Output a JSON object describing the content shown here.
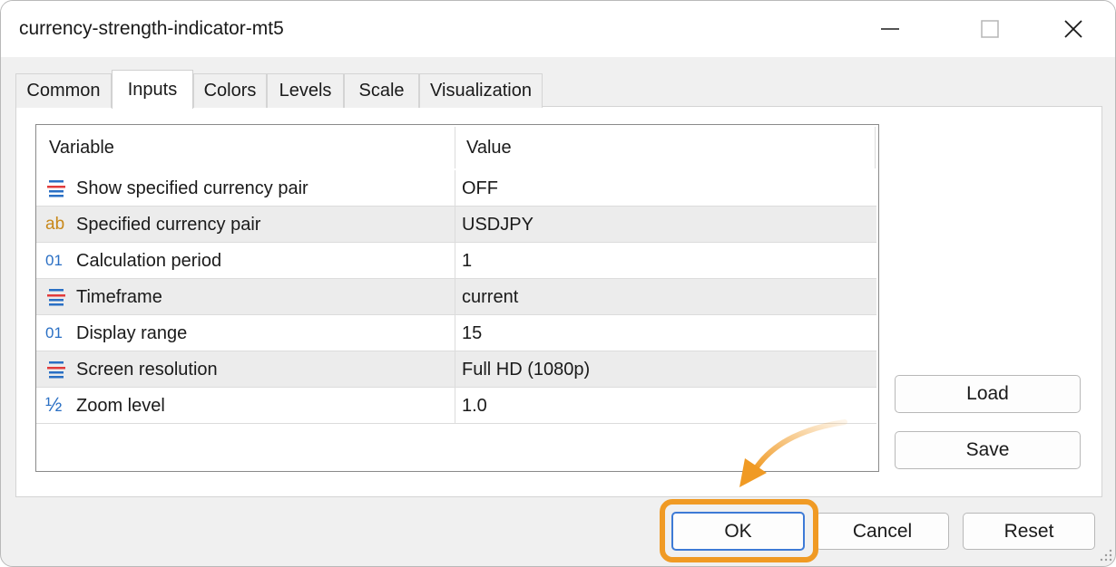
{
  "window": {
    "title": "currency-strength-indicator-mt5"
  },
  "tabs": [
    {
      "label": "Common",
      "active": false
    },
    {
      "label": "Inputs",
      "active": true
    },
    {
      "label": "Colors",
      "active": false
    },
    {
      "label": "Levels",
      "active": false
    },
    {
      "label": "Scale",
      "active": false
    },
    {
      "label": "Visualization",
      "active": false
    }
  ],
  "grid": {
    "headers": {
      "variable": "Variable",
      "value": "Value"
    },
    "rows": [
      {
        "icon": "enum-icon",
        "variable": "Show specified currency pair",
        "value": "OFF"
      },
      {
        "icon": "string-icon",
        "icon_text": "ab",
        "variable": "Specified currency pair",
        "value": "USDJPY"
      },
      {
        "icon": "integer-icon",
        "icon_text": "01",
        "variable": "Calculation period",
        "value": "1"
      },
      {
        "icon": "enum-icon",
        "variable": "Timeframe",
        "value": "current"
      },
      {
        "icon": "integer-icon",
        "icon_text": "01",
        "variable": "Display range",
        "value": "15"
      },
      {
        "icon": "enum-icon",
        "variable": "Screen resolution",
        "value": "Full HD (1080p)"
      },
      {
        "icon": "fraction-icon",
        "icon_text": "½",
        "variable": "Zoom level",
        "value": "1.0"
      }
    ]
  },
  "buttons": {
    "load": "Load",
    "save": "Save",
    "ok": "OK",
    "cancel": "Cancel",
    "reset": "Reset"
  },
  "colors": {
    "highlight": "#f09a24",
    "focus": "#3d7ad6"
  }
}
